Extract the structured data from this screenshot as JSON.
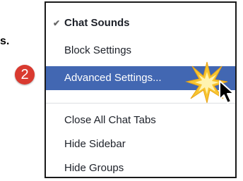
{
  "background_text": "s.",
  "step_badge": "2",
  "menu": {
    "items": [
      {
        "label": "Chat Sounds",
        "checked": true,
        "bold": true
      },
      {
        "label": "Block Settings"
      },
      {
        "label": "Advanced Settings...",
        "highlighted": true
      },
      {
        "label": "Close All Chat Tabs"
      },
      {
        "label": "Hide Sidebar"
      },
      {
        "label": "Hide Groups"
      }
    ]
  },
  "colors": {
    "highlight": "#4267b2",
    "badge": "#d93a30",
    "star": "#f7c530"
  },
  "icons": [
    "check-icon",
    "star-burst-icon",
    "mouse-cursor-icon"
  ]
}
